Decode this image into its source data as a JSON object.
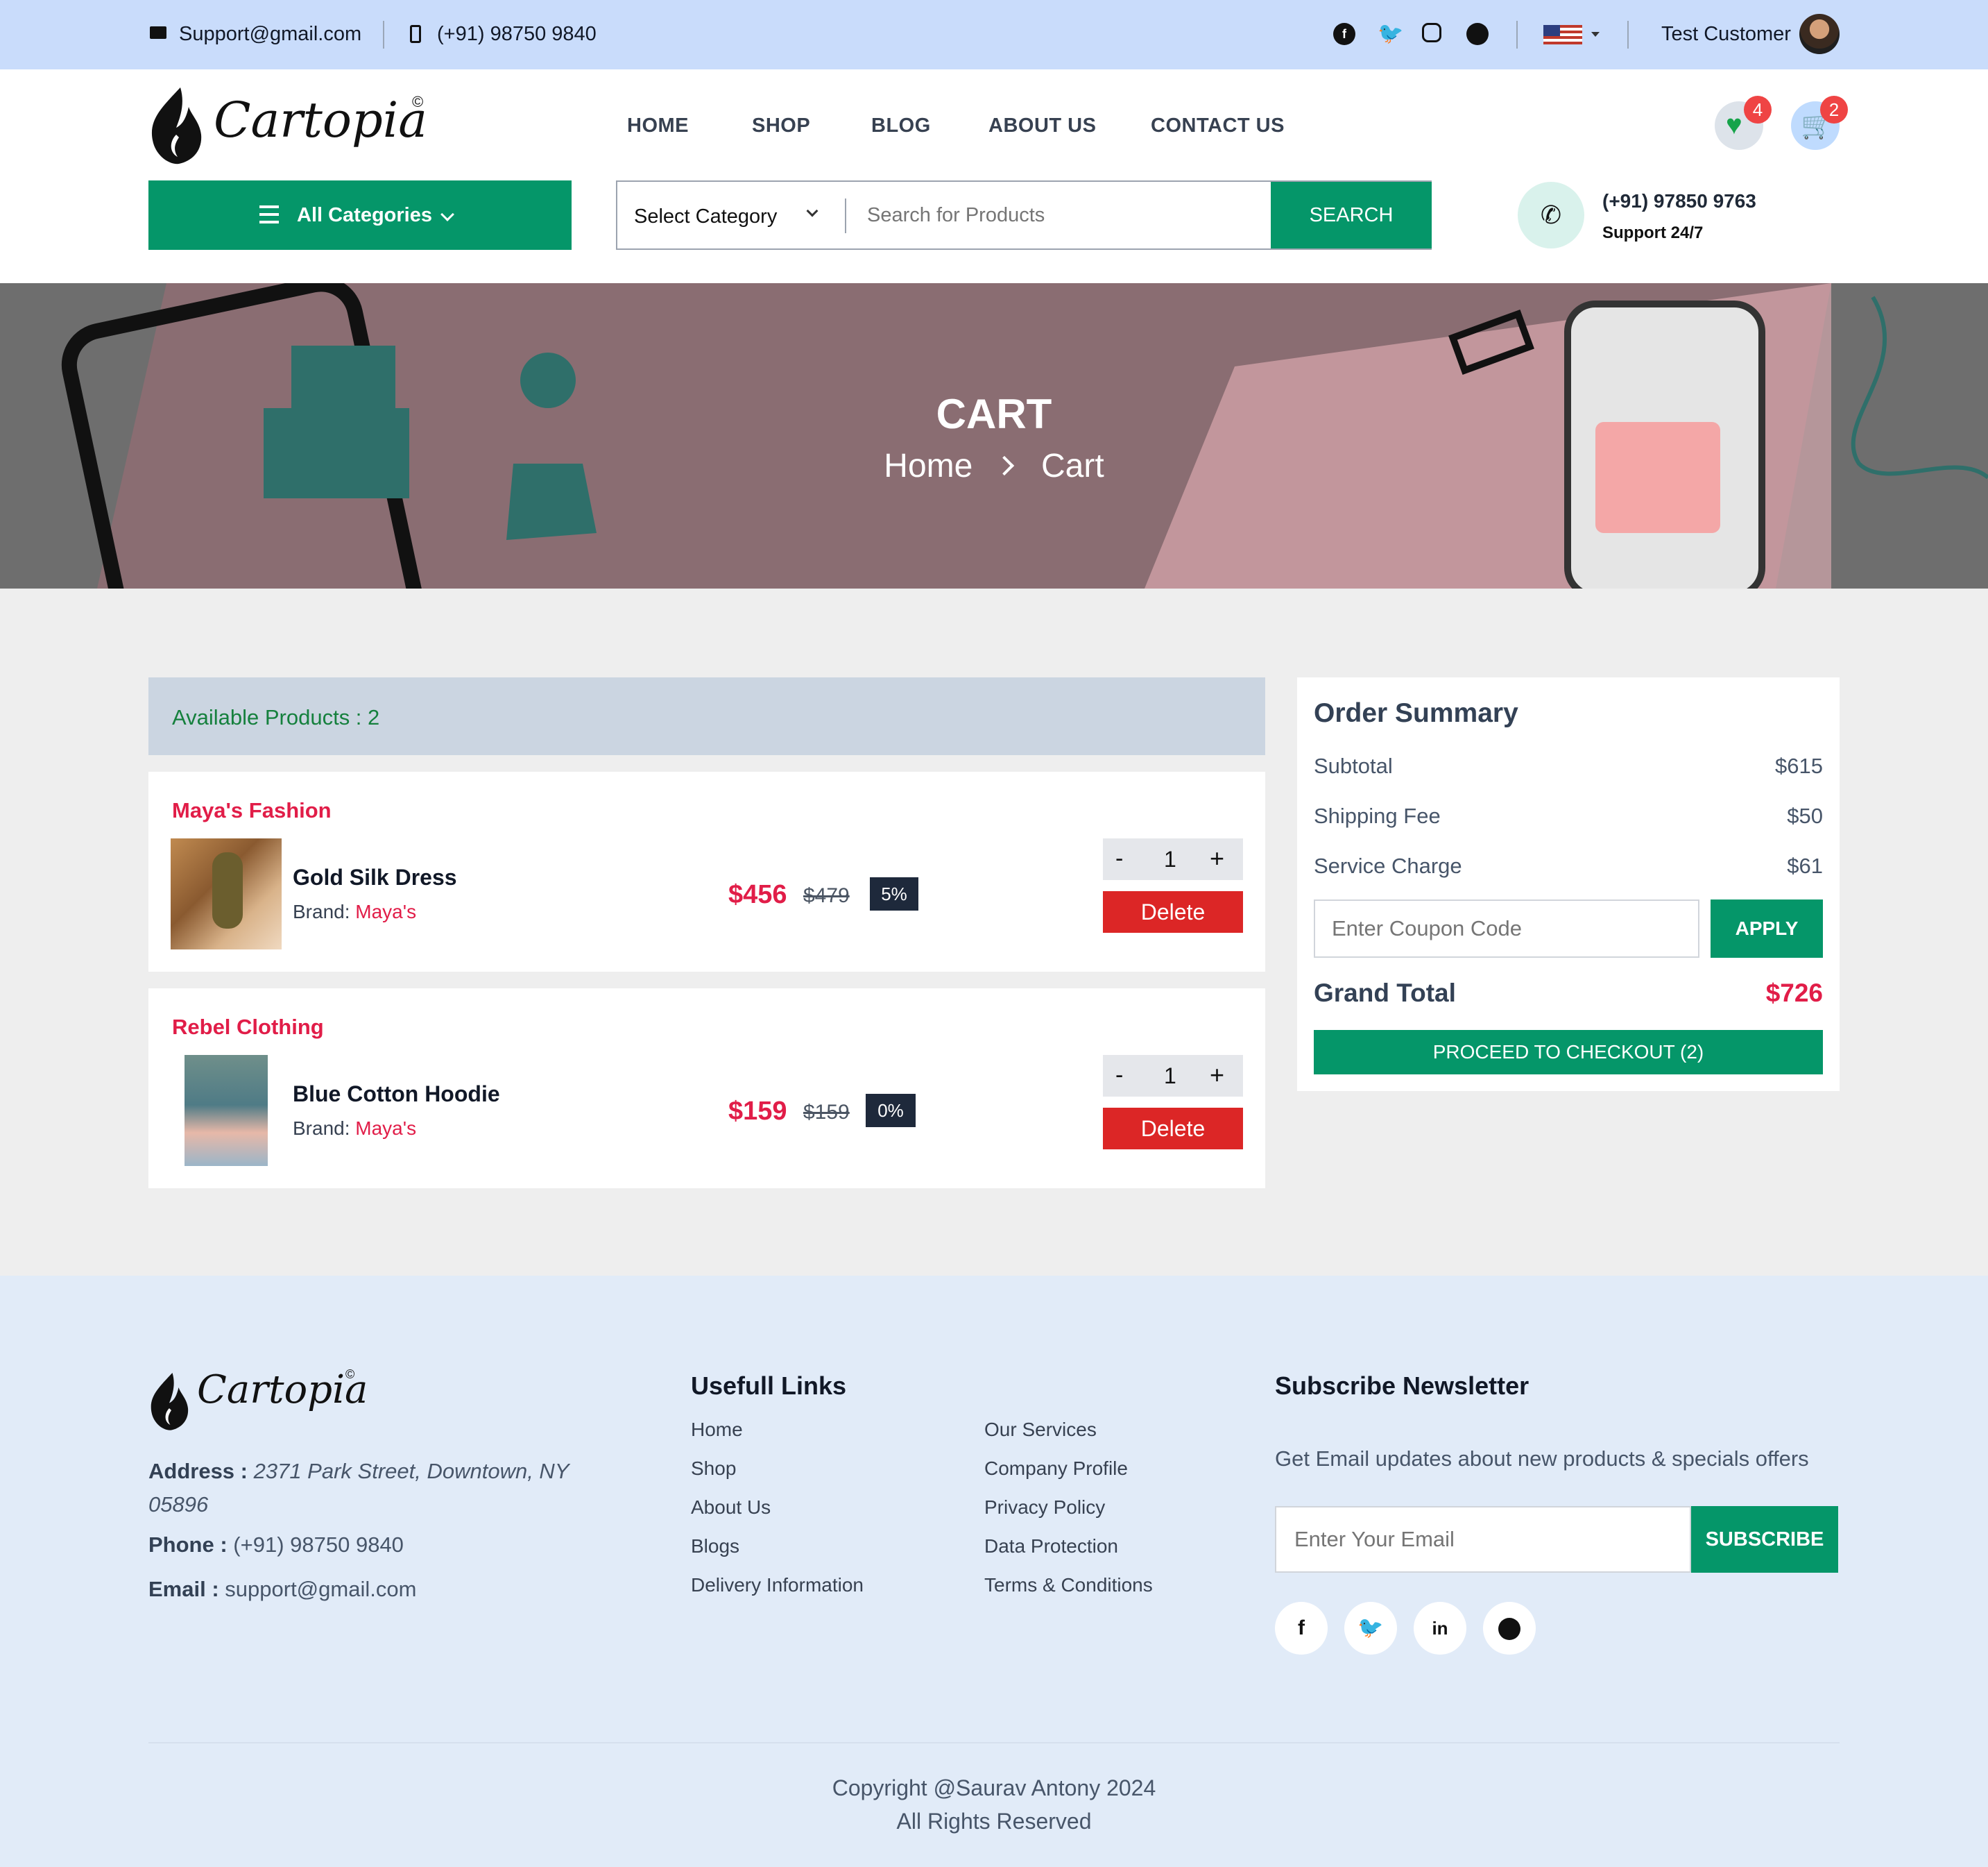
{
  "topbar": {
    "email": "Support@gmail.com",
    "phone": "(+91) 98750 9840",
    "user_name": "Test Customer"
  },
  "brand": {
    "name": "Cartopia",
    "mark": "©"
  },
  "nav": [
    "HOME",
    "SHOP",
    "BLOG",
    "ABOUT US",
    "CONTACT US"
  ],
  "badges": {
    "wishlist_count": "4",
    "cart_count": "2"
  },
  "search": {
    "all_categories": "All Categories",
    "select_category": "Select Category",
    "placeholder": "Search for Products",
    "button": "SEARCH"
  },
  "support": {
    "phone": "(+91) 97850 9763",
    "label": "Support 24/7"
  },
  "hero": {
    "title": "CART",
    "crumb_home": "Home",
    "crumb_current": "Cart"
  },
  "cart": {
    "available_label": "Available Products : 2",
    "delete_label": "Delete",
    "brand_prefix": "Brand:",
    "items": [
      {
        "shop": "Maya's Fashion",
        "name": "Gold Silk Dress",
        "brand": "Maya's",
        "price": "$456",
        "old_price": "$479",
        "discount": "5%",
        "qty": "1"
      },
      {
        "shop": "Rebel Clothing",
        "name": "Blue Cotton Hoodie",
        "brand": "Maya's",
        "price": "$159",
        "old_price": "$159",
        "discount": "0%",
        "qty": "1"
      }
    ]
  },
  "summary": {
    "title": "Order Summary",
    "rows": [
      {
        "label": "Subtotal",
        "value": "$615"
      },
      {
        "label": "Shipping Fee",
        "value": "$50"
      },
      {
        "label": "Service Charge",
        "value": "$61"
      }
    ],
    "coupon_placeholder": "Enter Coupon Code",
    "apply": "APPLY",
    "grand_label": "Grand Total",
    "grand_value": "$726",
    "checkout": "PROCEED TO CHECKOUT (2)"
  },
  "footer": {
    "address_label": "Address :",
    "address_line1": "2371 Park Street, Downtown, NY",
    "address_line2": "05896",
    "phone_label": "Phone :",
    "phone": "(+91) 98750 9840",
    "email_label": "Email :",
    "email": "support@gmail.com",
    "links_title": "Usefull Links",
    "links_col1": [
      "Home",
      "Shop",
      "About Us",
      "Blogs",
      "Delivery Information"
    ],
    "links_col2": [
      "Our Services",
      "Company Profile",
      "Privacy Policy",
      "Data Protection",
      "Terms & Conditions"
    ],
    "newsletter_title": "Subscribe Newsletter",
    "newsletter_text": "Get Email updates about new products & specials offers",
    "email_placeholder": "Enter Your Email",
    "subscribe": "SUBSCRIBE",
    "copyright": "Copyright @Saurav Antony 2024",
    "rights": "All Rights Reserved"
  },
  "colors": {
    "accent": "#059669",
    "price": "#e11d48",
    "danger": "#dc2626",
    "topbar": "#c9dcfb",
    "footer": "#e1ebf8"
  }
}
